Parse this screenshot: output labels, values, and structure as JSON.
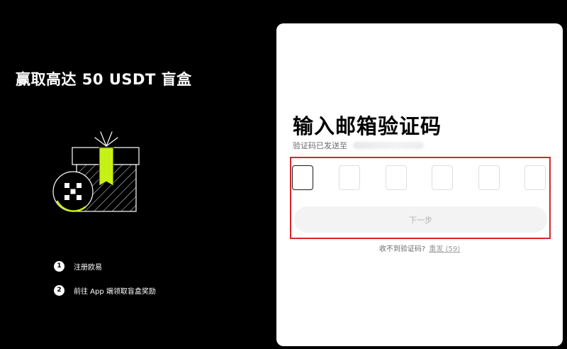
{
  "promo": {
    "title": "赢取高达 50 USDT 盲盒",
    "steps": [
      {
        "number": "1",
        "label": "注册欧易"
      },
      {
        "number": "2",
        "label": "前往 App 端领取盲盒奖励"
      }
    ]
  },
  "form": {
    "title": "输入邮箱验证码",
    "sent_label": "验证码已发送至",
    "code_length": 6,
    "next_button": "下一步",
    "resend_prompt": "收不到验证码?",
    "resend_link": "重发 (59)"
  },
  "colors": {
    "accent": "#c7f016",
    "highlight": "#d6262b"
  }
}
